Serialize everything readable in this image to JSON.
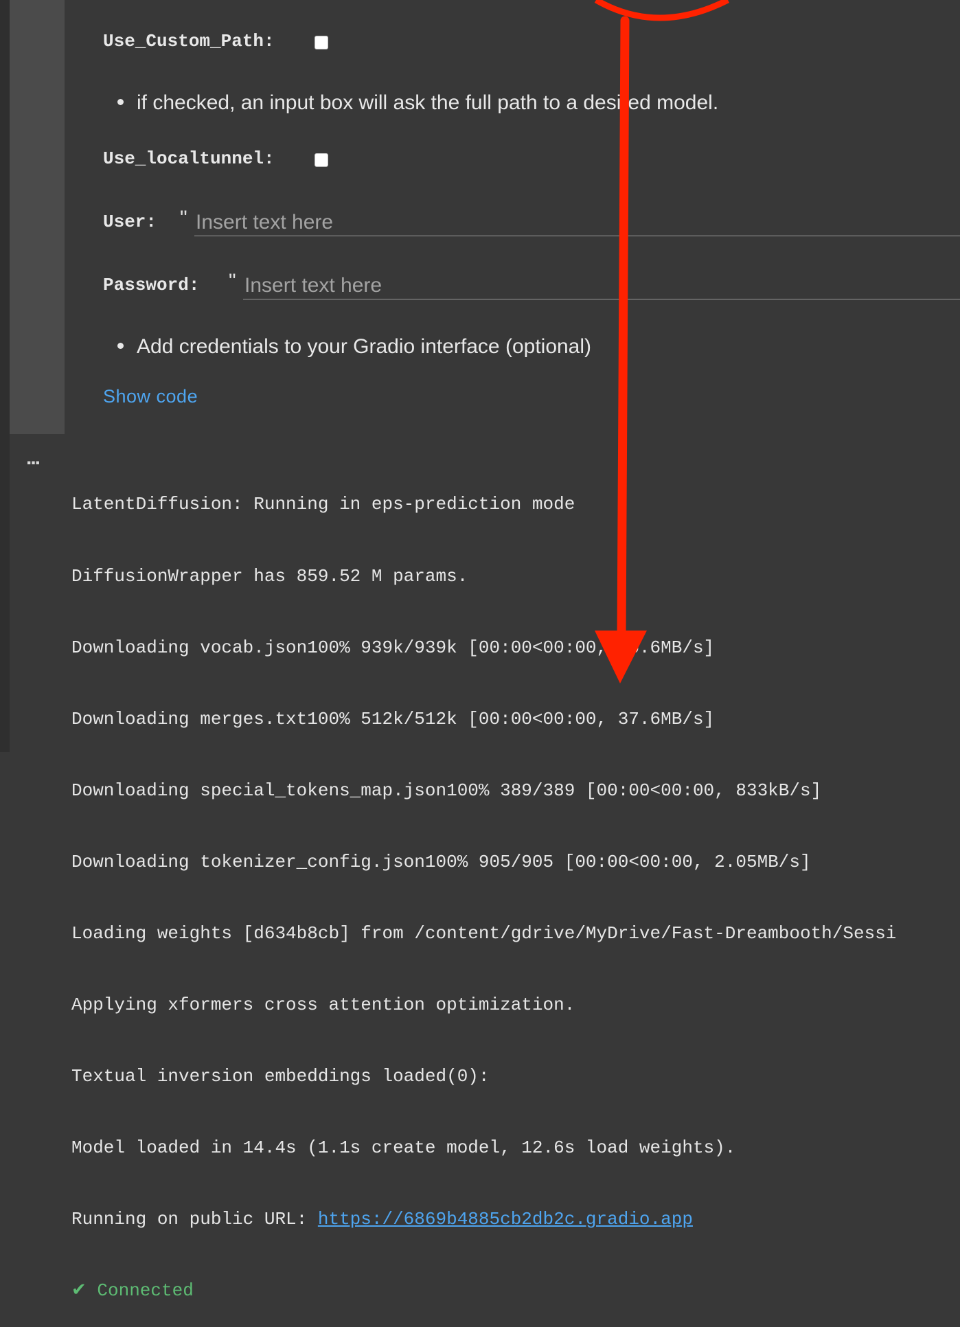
{
  "form": {
    "use_custom_path_label": "Use_Custom_Path:",
    "custom_path_hint": "if checked, an input box will ask the full path to a desired model.",
    "use_localtunnel_label": "Use_localtunnel:",
    "user_label": "User:",
    "user_quote": "\"",
    "user_placeholder": "Insert text here",
    "user_value": "",
    "password_label": "Password:",
    "password_quote": "\"",
    "password_placeholder": "Insert text here",
    "password_value": "",
    "credentials_hint": "Add credentials to your Gradio interface (optional)",
    "show_code_label": "Show code"
  },
  "output": {
    "menu_icon": "ellipsis-icon",
    "menu_glyph": "...",
    "lines": [
      "LatentDiffusion: Running in eps-prediction mode",
      "DiffusionWrapper has 859.52 M params.",
      "Downloading vocab.json100% 939k/939k [00:00<00:00, 46.6MB/s]",
      "Downloading merges.txt100% 512k/512k [00:00<00:00, 37.6MB/s]",
      "Downloading special_tokens_map.json100% 389/389 [00:00<00:00, 833kB/s]",
      "Downloading tokenizer_config.json100% 905/905 [00:00<00:00, 2.05MB/s]",
      "Loading weights [d634b8cb] from /content/gdrive/MyDrive/Fast-Dreambooth/Sessi",
      "Applying xformers cross attention optimization.",
      "Textual inversion embeddings loaded(0):",
      "Model loaded in 14.4s (1.1s create model, 12.6s load weights)."
    ],
    "url_prefix": "Running on public URL: ",
    "url": "https://6869b4885cb2db2c.gradio.app",
    "connected": "✔ Connected"
  },
  "colors": {
    "background": "#383838",
    "link": "#4ea5f0",
    "success": "#5dbb73",
    "annotation": "#ff2200"
  }
}
